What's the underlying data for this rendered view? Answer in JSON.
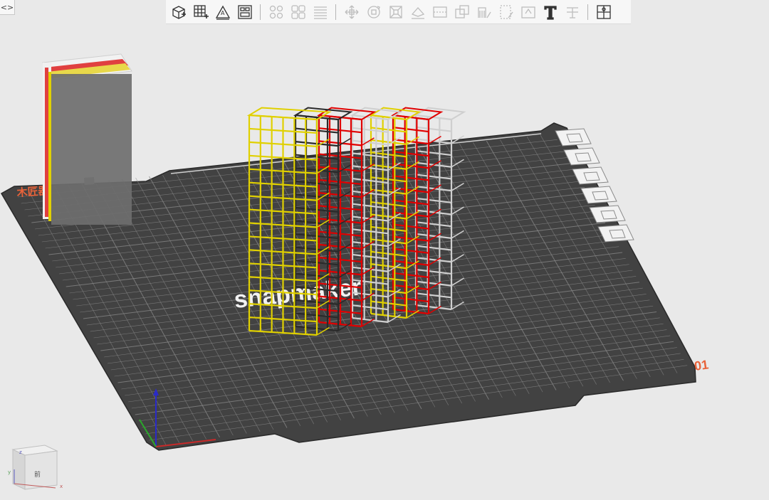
{
  "toggle": {
    "label": "<>"
  },
  "toolbar": {
    "groups": [
      [
        {
          "name": "add-object-icon",
          "enabled": true
        },
        {
          "name": "add-plate-icon",
          "enabled": true
        },
        {
          "name": "auto-orient-icon",
          "enabled": true
        },
        {
          "name": "arrange-icon",
          "enabled": true
        }
      ],
      [
        {
          "name": "split-objects-icon",
          "enabled": false
        },
        {
          "name": "split-parts-icon",
          "enabled": false
        },
        {
          "name": "layers-icon",
          "enabled": false
        }
      ],
      [
        {
          "name": "move-icon",
          "enabled": false
        },
        {
          "name": "rotate-icon",
          "enabled": false
        },
        {
          "name": "scale-icon",
          "enabled": false
        },
        {
          "name": "lay-on-face-icon",
          "enabled": false
        },
        {
          "name": "cut-icon",
          "enabled": false
        },
        {
          "name": "boolean-icon",
          "enabled": false
        },
        {
          "name": "support-paint-icon",
          "enabled": false
        },
        {
          "name": "seam-paint-icon",
          "enabled": false
        },
        {
          "name": "color-paint-icon",
          "enabled": false
        },
        {
          "name": "text-icon",
          "enabled": true
        },
        {
          "name": "measure-icon",
          "enabled": false
        }
      ],
      [
        {
          "name": "assembly-icon",
          "enabled": true
        }
      ]
    ]
  },
  "plate": {
    "number": "01",
    "brand_text": "snapmaker",
    "corner_text": "木匠器"
  },
  "plate_tools": [
    {
      "name": "plate-delete-icon"
    },
    {
      "name": "plate-orient-icon"
    },
    {
      "name": "plate-arrange-icon"
    },
    {
      "name": "plate-lock-icon"
    },
    {
      "name": "plate-settings-icon"
    },
    {
      "name": "plate-move-icon"
    }
  ],
  "view_cube": {
    "face_label": "前",
    "axis_x": "x",
    "axis_y": "y",
    "axis_z": "z"
  },
  "colors": {
    "bed": "#3f3f3f",
    "grid": "#8a8a8a",
    "plate_number": "#e8633a",
    "yellow": "#e0d000",
    "black": "#2a2a2a",
    "red": "#e00000",
    "white": "#cfcfcf"
  }
}
